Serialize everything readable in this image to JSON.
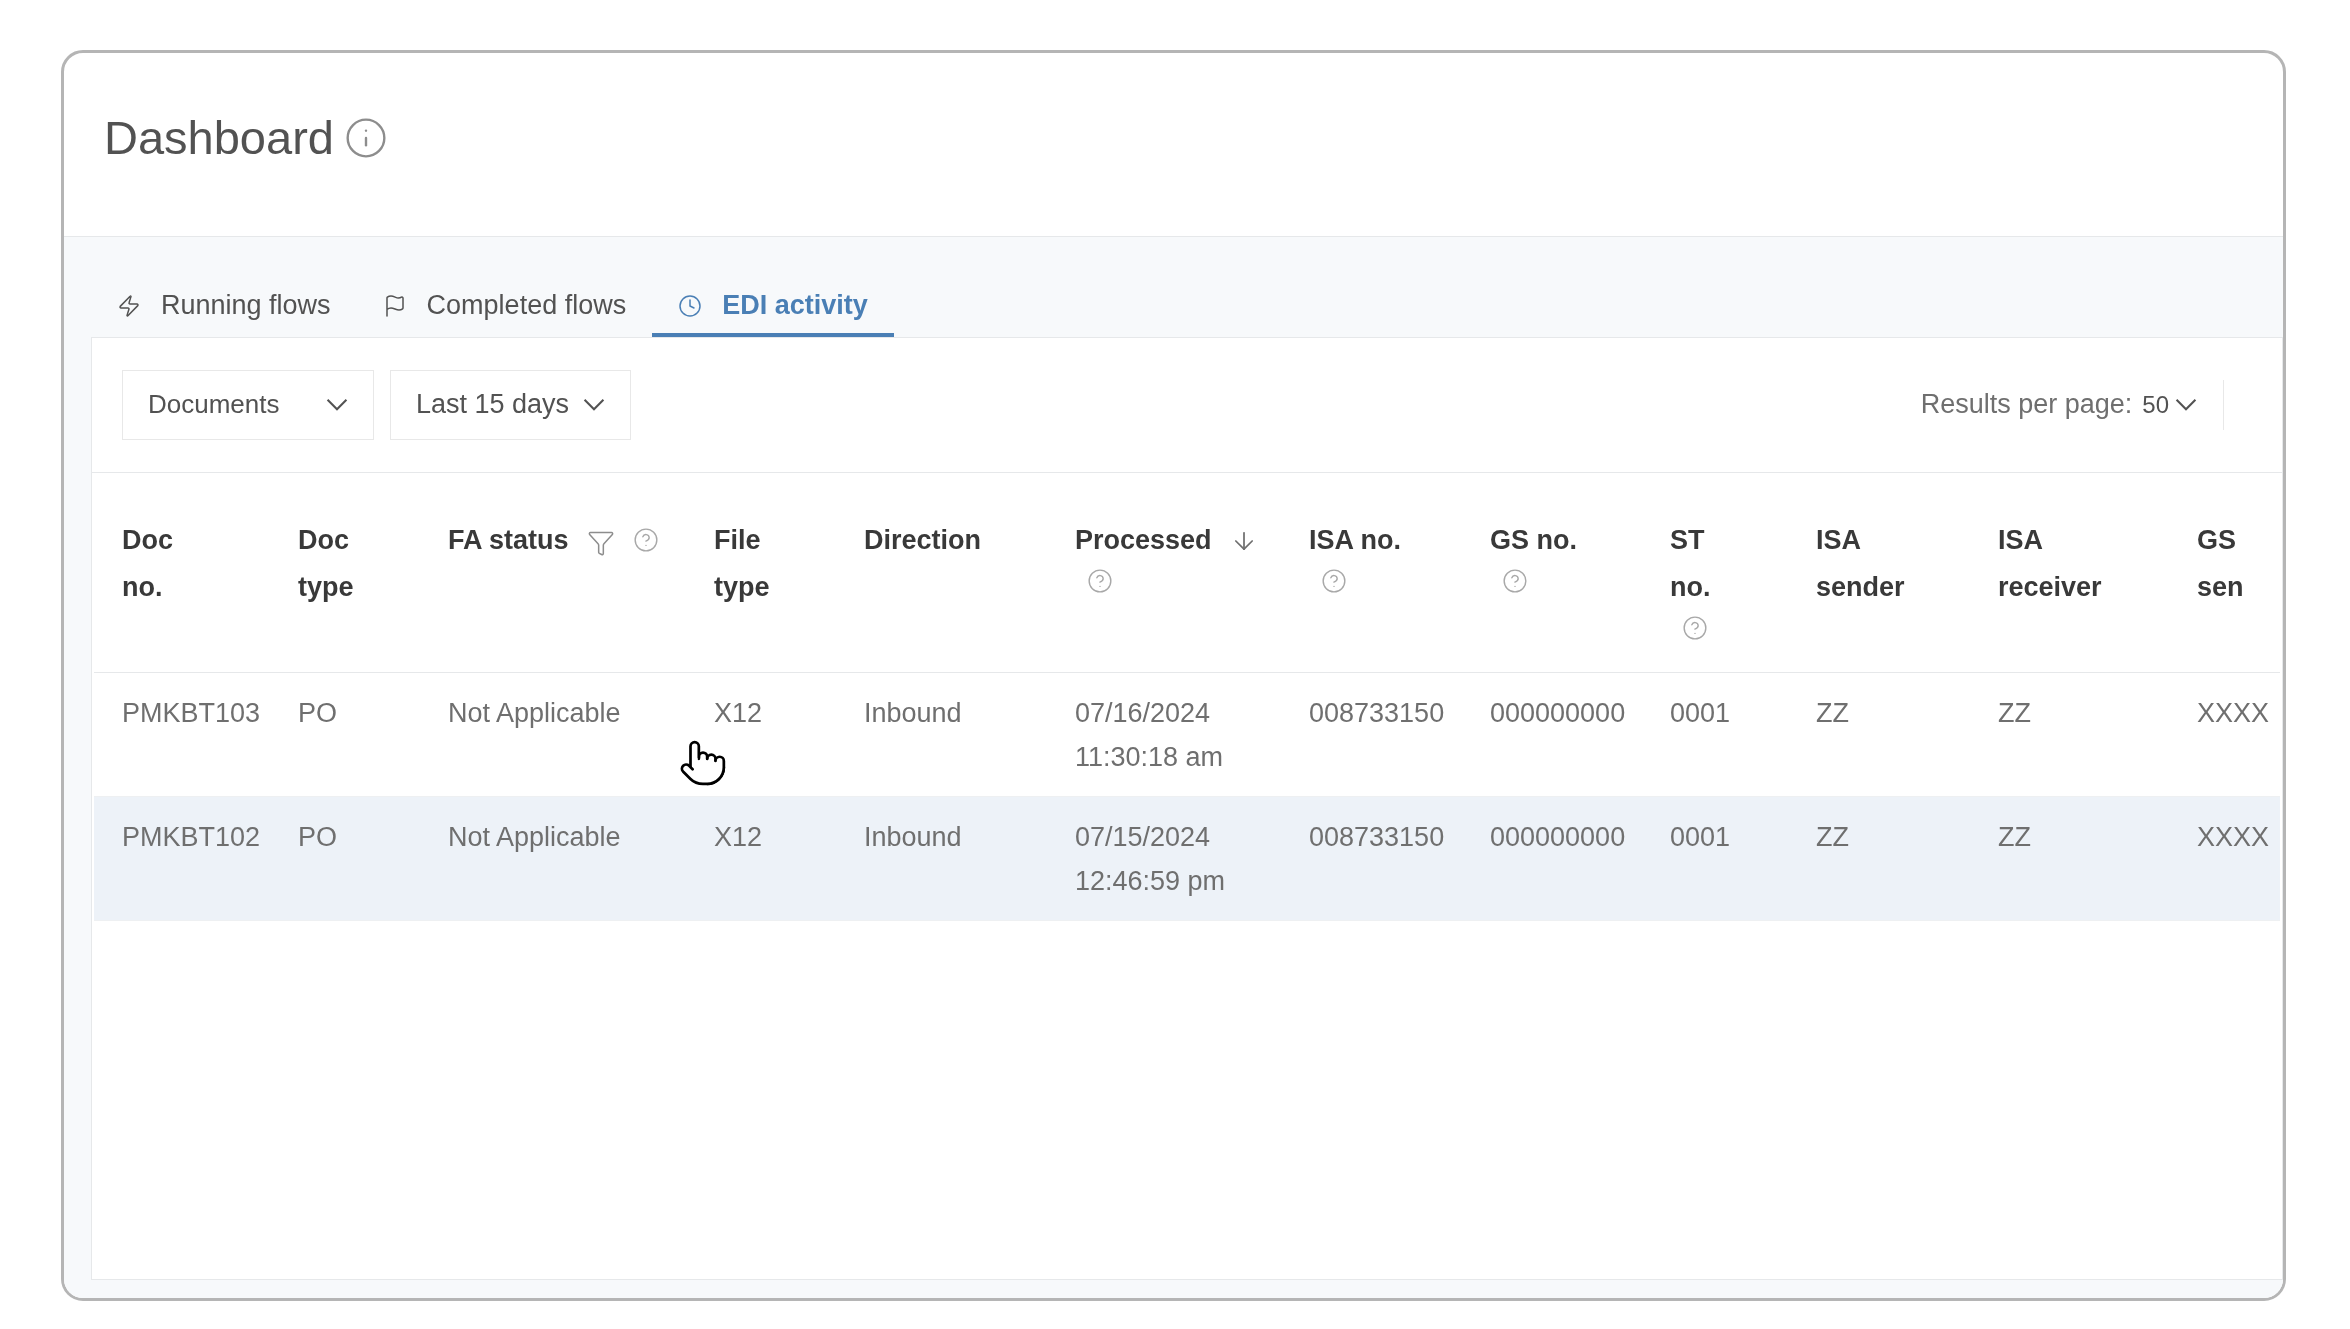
{
  "title": "Dashboard",
  "tabs": [
    {
      "label": "Running flows",
      "selected": false
    },
    {
      "label": "Completed flows",
      "selected": false
    },
    {
      "label": "EDI activity",
      "selected": true
    }
  ],
  "filters": [
    {
      "label": "Documents"
    },
    {
      "label": "Last 15 days"
    }
  ],
  "results_per_page": {
    "label": "Results per page:",
    "value": "50"
  },
  "table": {
    "columns": [
      {
        "label": "Doc no."
      },
      {
        "label": "Doc type"
      },
      {
        "label": "FA status",
        "filter": true,
        "help": true
      },
      {
        "label": "File type"
      },
      {
        "label": "Direction"
      },
      {
        "label": "Processed",
        "sorted": true,
        "help": true
      },
      {
        "label": "ISA no.",
        "help": true
      },
      {
        "label": "GS no.",
        "help": true
      },
      {
        "label": "ST no.",
        "help": true
      },
      {
        "label": "ISA sender"
      },
      {
        "label": "ISA receiver"
      },
      {
        "label": "GS sen"
      }
    ],
    "rows": [
      {
        "highlighted": false,
        "cells": [
          "PMKBT103",
          "PO",
          "Not Applicable",
          "X12",
          "Inbound",
          "07/16/2024 11:30:18 am",
          "008733150",
          "000000000",
          "0001",
          "ZZ",
          "ZZ",
          "XXXX"
        ]
      },
      {
        "highlighted": true,
        "cells": [
          "PMKBT102",
          "PO",
          "Not Applicable",
          "X12",
          "Inbound",
          "07/15/2024 12:46:59 pm",
          "008733150",
          "000000000",
          "0001",
          "ZZ",
          "ZZ",
          "XXXX"
        ]
      }
    ]
  }
}
